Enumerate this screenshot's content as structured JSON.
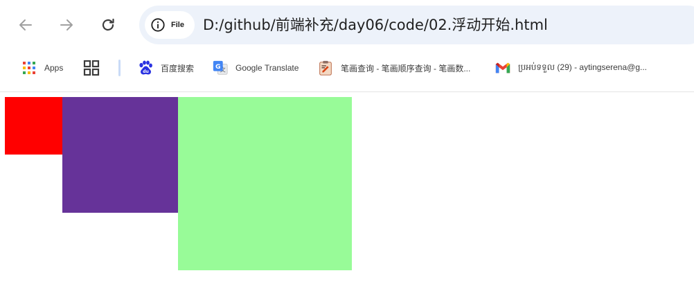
{
  "browser": {
    "address_bar": {
      "chip_label": "File",
      "url": "D:/github/前端补充/day06/code/02.浮动开始.html"
    },
    "bookmarks": [
      {
        "label": "Apps",
        "icon": "apps-grid-icon"
      },
      {
        "label": "",
        "icon": "tab-groups-icon"
      },
      {
        "label": "百度搜索",
        "icon": "baidu-paw-icon"
      },
      {
        "label": "Google Translate",
        "icon": "google-translate-icon"
      },
      {
        "label": "笔画查询 - 笔画顺序查询 - 笔画数...",
        "icon": "clipboard-icon"
      },
      {
        "label": "ប្រអប់ទទួល (29) - aytingserena@g...",
        "icon": "gmail-icon"
      }
    ]
  },
  "page": {
    "boxes": [
      {
        "name": "red-box",
        "color": "#ff0000"
      },
      {
        "name": "purple-box",
        "color": "#663399"
      },
      {
        "name": "green-box",
        "color": "#98fb98"
      }
    ]
  },
  "colors": {
    "omnibox_bg": "#edf2fa",
    "icon_gray": "#5f6368",
    "icon_disabled": "#a0a0a0"
  }
}
